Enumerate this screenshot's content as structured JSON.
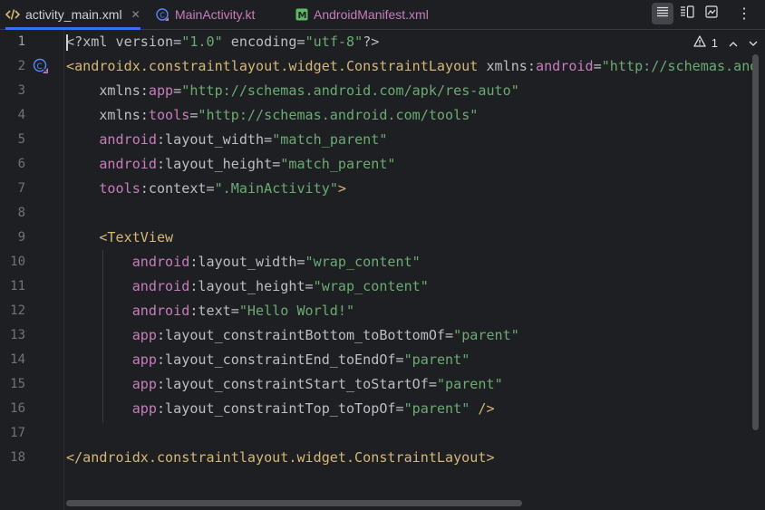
{
  "tabs": [
    {
      "label": "activity_main.xml",
      "icon": "xml-code-icon",
      "active": true
    },
    {
      "label": "MainActivity.kt",
      "icon": "kotlin-class-icon",
      "active": false
    },
    {
      "label": "AndroidManifest.xml",
      "icon": "manifest-icon",
      "active": false
    }
  ],
  "toolbar": {
    "close_glyph": "✕",
    "more_glyph": "⋮"
  },
  "inspections": {
    "warning_count": "1"
  },
  "colors": {
    "background": "#1e1f22",
    "accent": "#3574f0",
    "tag": "#d5b778",
    "namespace": "#c77dbb",
    "attribute": "#bcbec4",
    "string": "#6aab73",
    "line_number": "#6f737a"
  },
  "editor": {
    "current_line": "1",
    "lines": [
      {
        "num": "1",
        "segs": [
          [
            "p",
            "<?"
          ],
          [
            "attr",
            "xml version"
          ],
          [
            "p",
            "="
          ],
          [
            "val",
            "\"1.0\""
          ],
          [
            "attr",
            " encoding"
          ],
          [
            "p",
            "="
          ],
          [
            "val",
            "\"utf-8\""
          ],
          [
            "p",
            "?>"
          ]
        ]
      },
      {
        "num": "2",
        "segs": [
          [
            "tag",
            "<androidx.constraintlayout.widget.ConstraintLayout"
          ],
          [
            "attr",
            " xmlns:"
          ],
          [
            "ns",
            "android"
          ],
          [
            "p",
            "="
          ],
          [
            "val",
            "\"http://schemas.android.com/apk/res/android\""
          ]
        ]
      },
      {
        "num": "3",
        "segs": [
          [
            "attr",
            "    xmlns:"
          ],
          [
            "ns",
            "app"
          ],
          [
            "p",
            "="
          ],
          [
            "val",
            "\"http://schemas.android.com/apk/res-auto\""
          ]
        ]
      },
      {
        "num": "4",
        "segs": [
          [
            "attr",
            "    xmlns:"
          ],
          [
            "ns",
            "tools"
          ],
          [
            "p",
            "="
          ],
          [
            "val",
            "\"http://schemas.android.com/tools\""
          ]
        ]
      },
      {
        "num": "5",
        "segs": [
          [
            "ns",
            "    android"
          ],
          [
            "attr",
            ":layout_width"
          ],
          [
            "p",
            "="
          ],
          [
            "val",
            "\"match_parent\""
          ]
        ]
      },
      {
        "num": "6",
        "segs": [
          [
            "ns",
            "    android"
          ],
          [
            "attr",
            ":layout_height"
          ],
          [
            "p",
            "="
          ],
          [
            "val",
            "\"match_parent\""
          ]
        ]
      },
      {
        "num": "7",
        "segs": [
          [
            "ns",
            "    tools"
          ],
          [
            "attr",
            ":context"
          ],
          [
            "p",
            "="
          ],
          [
            "val",
            "\".MainActivity\""
          ],
          [
            "tag",
            ">"
          ]
        ]
      },
      {
        "num": "8",
        "segs": []
      },
      {
        "num": "9",
        "segs": [
          [
            "tag",
            "    <TextView"
          ]
        ]
      },
      {
        "num": "10",
        "segs": [
          [
            "ns",
            "        android"
          ],
          [
            "attr",
            ":layout_width"
          ],
          [
            "p",
            "="
          ],
          [
            "val",
            "\"wrap_content\""
          ]
        ]
      },
      {
        "num": "11",
        "segs": [
          [
            "ns",
            "        android"
          ],
          [
            "attr",
            ":layout_height"
          ],
          [
            "p",
            "="
          ],
          [
            "val",
            "\"wrap_content\""
          ]
        ]
      },
      {
        "num": "12",
        "segs": [
          [
            "ns",
            "        android"
          ],
          [
            "attr",
            ":text"
          ],
          [
            "p",
            "="
          ],
          [
            "val",
            "\"Hello World!\""
          ]
        ]
      },
      {
        "num": "13",
        "segs": [
          [
            "ns",
            "        app"
          ],
          [
            "attr",
            ":layout_constraintBottom_toBottomOf"
          ],
          [
            "p",
            "="
          ],
          [
            "val",
            "\"parent\""
          ]
        ]
      },
      {
        "num": "14",
        "segs": [
          [
            "ns",
            "        app"
          ],
          [
            "attr",
            ":layout_constraintEnd_toEndOf"
          ],
          [
            "p",
            "="
          ],
          [
            "val",
            "\"parent\""
          ]
        ]
      },
      {
        "num": "15",
        "segs": [
          [
            "ns",
            "        app"
          ],
          [
            "attr",
            ":layout_constraintStart_toStartOf"
          ],
          [
            "p",
            "="
          ],
          [
            "val",
            "\"parent\""
          ]
        ]
      },
      {
        "num": "16",
        "segs": [
          [
            "ns",
            "        app"
          ],
          [
            "attr",
            ":layout_constraintTop_toTopOf"
          ],
          [
            "p",
            "="
          ],
          [
            "val",
            "\"parent\""
          ],
          [
            "tag",
            " />"
          ]
        ]
      },
      {
        "num": "17",
        "segs": []
      },
      {
        "num": "18",
        "segs": [
          [
            "tag",
            "</androidx.constraintlayout.widget.ConstraintLayout>"
          ]
        ]
      }
    ]
  }
}
